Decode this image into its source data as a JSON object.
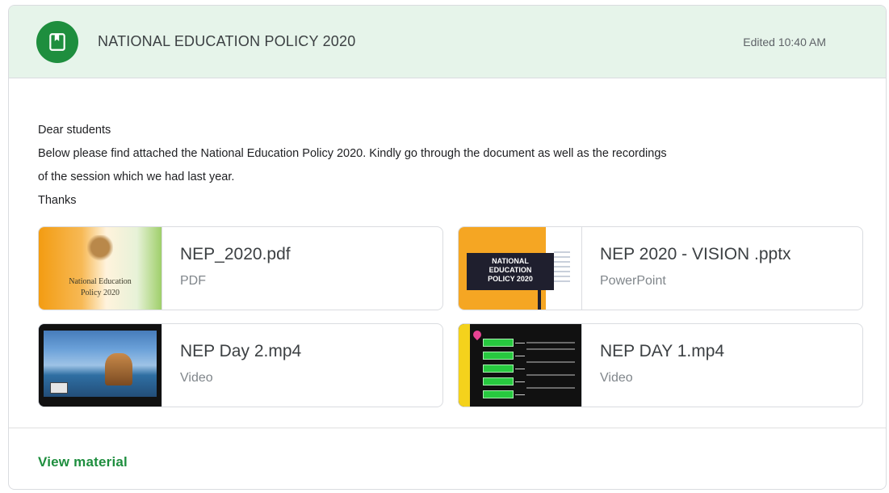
{
  "header": {
    "icon": "material-doc-icon",
    "title": "NATIONAL EDUCATION POLICY 2020",
    "edited": "Edited 10:40 AM",
    "accent_color": "#1e8e3e",
    "background_color": "#e6f4ea"
  },
  "body": {
    "lines": [
      "Dear students",
      "Below please find attached the National Education Policy 2020. Kindly go through the document as well as the recordings",
      "of the session which we had last year.",
      "Thanks"
    ]
  },
  "attachments": [
    {
      "name": "NEP_2020.pdf",
      "type": "PDF",
      "thumb_lines": [
        "National Education",
        "Policy 2020"
      ]
    },
    {
      "name": "NEP 2020 - VISION .pptx",
      "type": "PowerPoint",
      "thumb_lines": [
        "NATIONAL",
        "EDUCATION",
        "POLICY 2020"
      ]
    },
    {
      "name": "NEP Day 2.mp4",
      "type": "Video"
    },
    {
      "name": "NEP DAY 1.mp4",
      "type": "Video"
    }
  ],
  "footer": {
    "view_material": "View material",
    "link_color": "#1e8e3e"
  }
}
